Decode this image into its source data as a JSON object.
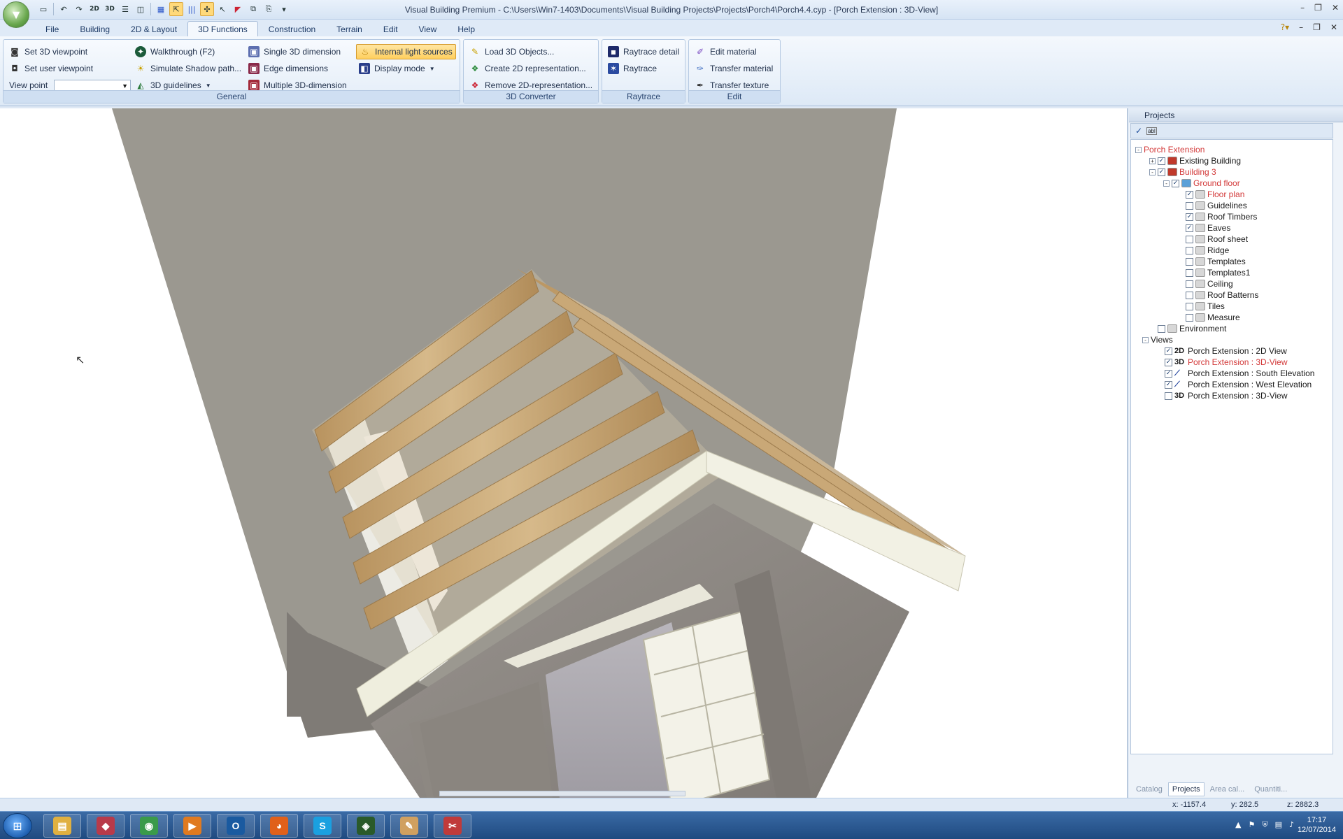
{
  "titlebar": {
    "window_title": "Visual Building Premium - C:\\Users\\Win7-1403\\Documents\\Visual Building Projects\\Projects\\Porch4\\Porch4.4.cyp - [Porch Extension : 3D-View]",
    "quick_access": [
      "new-icon",
      "undo-icon",
      "redo-icon",
      "2D",
      "3D",
      "split-h-icon",
      "split-v-icon",
      "grid-icon",
      "select-icon",
      "hatch-icon",
      "snap-icon",
      "pointer-icon",
      "measure-icon",
      "copy-icon",
      "paste-icon",
      "more-icon"
    ]
  },
  "menu": {
    "tabs": [
      "File",
      "Building",
      "2D & Layout",
      "3D Functions",
      "Construction",
      "Terrain",
      "Edit",
      "View",
      "Help"
    ],
    "active_tab": "3D Functions"
  },
  "ribbon": {
    "general": {
      "label": "General",
      "set_3d_viewpoint": "Set 3D viewpoint",
      "set_user_viewpoint": "Set user viewpoint",
      "view_point_label": "View point",
      "view_point_value": "",
      "walkthrough": "Walkthrough (F2)",
      "simulate_shadow": "Simulate Shadow path...",
      "guidelines_3d": "3D guidelines",
      "single_3d_dimension": "Single 3D dimension",
      "edge_dimensions": "Edge dimensions",
      "multiple_3d_dimension": "Multiple 3D-dimension",
      "internal_light_sources": "Internal light sources",
      "display_mode": "Display mode"
    },
    "converter": {
      "label": "3D Converter",
      "load_3d_objects": "Load 3D Objects...",
      "create_2d": "Create 2D representation...",
      "remove_2d": "Remove 2D-representation..."
    },
    "raytrace": {
      "label": "Raytrace",
      "raytrace_detail": "Raytrace detail",
      "raytrace": "Raytrace"
    },
    "edit": {
      "label": "Edit",
      "edit_material": "Edit material",
      "transfer_material": "Transfer material",
      "transfer_texture": "Transfer texture"
    }
  },
  "projects_panel": {
    "title": "Projects",
    "tree": [
      {
        "label": "Porch Extension",
        "level": 0,
        "expander": "-",
        "check": "",
        "red": true,
        "icon": "none"
      },
      {
        "label": "Existing Building",
        "level": 1,
        "expander": "+",
        "check": "✓",
        "red": false,
        "icon": "building"
      },
      {
        "label": "Building 3",
        "level": 1,
        "expander": "-",
        "check": "✓",
        "red": true,
        "icon": "building"
      },
      {
        "label": "Ground floor",
        "level": 2,
        "expander": "-",
        "check": "✓",
        "red": true,
        "icon": "floor"
      },
      {
        "label": "Floor plan",
        "level": 3,
        "expander": "",
        "check": "✓",
        "red": true,
        "icon": "layer"
      },
      {
        "label": "Guidelines",
        "level": 3,
        "expander": "",
        "check": "",
        "red": false,
        "icon": "layer"
      },
      {
        "label": "Roof Timbers",
        "level": 3,
        "expander": "",
        "check": "✓",
        "red": false,
        "icon": "layer"
      },
      {
        "label": "Eaves",
        "level": 3,
        "expander": "",
        "check": "✓",
        "red": false,
        "icon": "layer"
      },
      {
        "label": "Roof sheet",
        "level": 3,
        "expander": "",
        "check": "",
        "red": false,
        "icon": "layer"
      },
      {
        "label": "Ridge",
        "level": 3,
        "expander": "",
        "check": "",
        "red": false,
        "icon": "layer"
      },
      {
        "label": "Templates",
        "level": 3,
        "expander": "",
        "check": "",
        "red": false,
        "icon": "layer"
      },
      {
        "label": "Templates1",
        "level": 3,
        "expander": "",
        "check": "",
        "red": false,
        "icon": "layer"
      },
      {
        "label": "Ceiling",
        "level": 3,
        "expander": "",
        "check": "",
        "red": false,
        "icon": "layer"
      },
      {
        "label": "Roof Batterns",
        "level": 3,
        "expander": "",
        "check": "",
        "red": false,
        "icon": "layer"
      },
      {
        "label": "Tiles",
        "level": 3,
        "expander": "",
        "check": "",
        "red": false,
        "icon": "layer"
      },
      {
        "label": "Measure",
        "level": 3,
        "expander": "",
        "check": "",
        "red": false,
        "icon": "layer"
      },
      {
        "label": "Environment",
        "level": 1,
        "expander": "",
        "check": "",
        "red": false,
        "icon": "layer"
      },
      {
        "label": "Views",
        "level": 0.5,
        "expander": "-",
        "check": "none",
        "red": false,
        "icon": "none"
      },
      {
        "label": "Porch Extension : 2D View",
        "level": 1.5,
        "expander": "",
        "check": "✓",
        "red": false,
        "icon": "2D"
      },
      {
        "label": "Porch Extension : 3D-View",
        "level": 1.5,
        "expander": "",
        "check": "✓",
        "red": true,
        "icon": "3D"
      },
      {
        "label": "Porch Extension : South Elevation",
        "level": 1.5,
        "expander": "",
        "check": "✓",
        "red": false,
        "icon": "elev"
      },
      {
        "label": "Porch Extension : West Elevation",
        "level": 1.5,
        "expander": "",
        "check": "✓",
        "red": false,
        "icon": "elev"
      },
      {
        "label": "Porch Extension : 3D-View",
        "level": 1.5,
        "expander": "",
        "check": "",
        "red": false,
        "icon": "3D"
      }
    ],
    "tabs": [
      "Catalog",
      "Projects",
      "Area cal...",
      "Quantiti..."
    ],
    "active_tab": "Projects"
  },
  "status": {
    "x": "x: -1157.4",
    "y": "y: 282.5",
    "z": "z: 2882.3"
  },
  "taskbar": {
    "apps": [
      "Explorer",
      "Visual Building",
      "Chrome",
      "Media Player",
      "Outlook",
      "Firefox",
      "Skype",
      "Monitor",
      "Paint",
      "Snipping Tool"
    ],
    "time": "17:17",
    "date": "12/07/2014"
  },
  "colors": {
    "accent_red": "#d33a3a",
    "highlight": "#ffcf5e",
    "timber": "#c9a877",
    "wall": "#8a8580",
    "fascia": "#efeede"
  }
}
